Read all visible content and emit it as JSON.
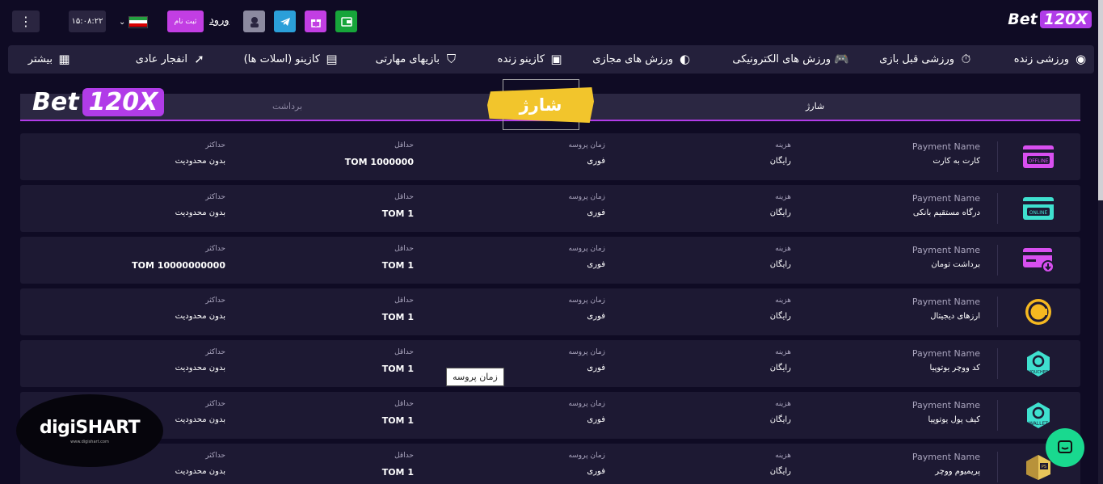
{
  "header": {
    "logo_text": "Bet",
    "logo_num": "120X",
    "clock": "۱۵:۰۸:۲۲",
    "signup_label": "ثبت نام",
    "login_label": "ورود",
    "menu_icon": "kebab-menu-icon"
  },
  "nav": {
    "items": [
      {
        "label": "ورزشی زنده",
        "icon": "live-icon"
      },
      {
        "label": "ورزشی قبل بازی",
        "icon": "stopwatch-icon"
      },
      {
        "label": "ورزش های الکترونیکی",
        "icon": "gamepad-icon"
      },
      {
        "label": "ورزش های مجازی",
        "icon": "virtual-icon"
      },
      {
        "label": "کازینو زنده",
        "icon": "tv-icon"
      },
      {
        "label": "بازیهای مهارتی",
        "icon": "shield-icon"
      },
      {
        "label": "کازینو (اسلات ها)",
        "icon": "slot-icon"
      },
      {
        "label": "انفجار عادی",
        "icon": "rocket-icon"
      },
      {
        "label": "بیشتر",
        "icon": "grid-icon"
      }
    ]
  },
  "brand": {
    "text": "Bet",
    "num": "120X"
  },
  "tabs": {
    "deposit": "شارژ",
    "withdraw": "برداشت",
    "banner": "شارژ"
  },
  "labels": {
    "payment_name": "Payment Name",
    "cost": "هزینه",
    "process_time": "زمان پروسه",
    "min": "حداقل",
    "max": "حداکثر"
  },
  "rows": [
    {
      "name": "کارت به کارت",
      "cost": "رایگان",
      "time": "فوری",
      "min": "TOM 1000000",
      "max": "بدون محدودیت",
      "icon": "offline-card-icon"
    },
    {
      "name": "درگاه مستقیم بانکی",
      "cost": "رایگان",
      "time": "فوری",
      "min": "TOM 1",
      "max": "بدون محدودیت",
      "icon": "online-card-icon"
    },
    {
      "name": "برداشت تومان",
      "cost": "رایگان",
      "time": "فوری",
      "min": "TOM 1",
      "max": "TOM 10000000000",
      "icon": "withdraw-card-icon"
    },
    {
      "name": "ارزهای دیجیتال",
      "cost": "رایگان",
      "time": "فوری",
      "min": "TOM 1",
      "max": "بدون محدودیت",
      "icon": "crypto-coin-icon"
    },
    {
      "name": "کد ووچر یوتوپیا",
      "cost": "رایگان",
      "time": "فوری",
      "min": "TOM 1",
      "max": "بدون محدودیت",
      "icon": "voucher-icon"
    },
    {
      "name": "کیف پول یوتوپیا",
      "cost": "رایگان",
      "time": "فوری",
      "min": "TOM 1",
      "max": "بدون محدودیت",
      "icon": "wallet-icon"
    },
    {
      "name": "پریمیوم ووچر",
      "cost": "رایگان",
      "time": "فوری",
      "min": "TOM 1",
      "max": "بدون محدودیت",
      "icon": "premium-voucher-icon"
    }
  ],
  "tooltip": "زمان پروسه",
  "watermark": {
    "text": "digiSHART",
    "sub": "www.digishart.com"
  },
  "colors": {
    "accent": "#b13ce8",
    "background": "#0f0b24",
    "row": "#1d1933",
    "chat": "#19d98f",
    "banner": "#f2c52c"
  }
}
